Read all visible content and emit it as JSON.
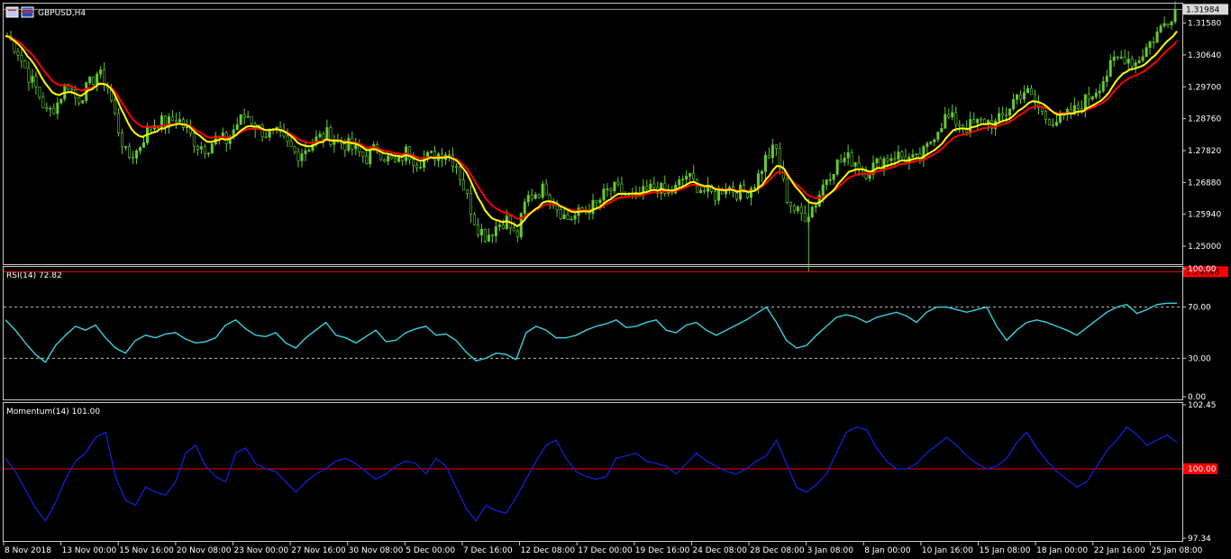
{
  "window": {
    "symbol_title": "GBPUSD,H4"
  },
  "colors": {
    "background": "#000000",
    "frame": "#c8c8c8",
    "candle": "#66cc33",
    "ma_fast": "#ffff00",
    "ma_slow": "#ff0000",
    "rsi_line": "#3ad0e0",
    "momentum_line": "#1020c8",
    "level_line": "#ff0000",
    "label_text": "#ffffff",
    "price_box_bg": "#d8d8d8",
    "price_box_red": "#ff0000"
  },
  "chart_data": [
    {
      "type": "candlestick",
      "panel": "price",
      "title": "GBPUSD,H4",
      "ylim": [
        1.2455,
        1.321
      ],
      "y_ticks": [
        "1.31580",
        "1.30640",
        "1.29700",
        "1.28760",
        "1.27820",
        "1.26880",
        "1.25940",
        "1.25000"
      ],
      "current_price_label": "1.31984",
      "current_price": 1.31984,
      "low_line_label": "1.24248",
      "low_line": 1.24248,
      "close_path": [
        1.312,
        1.308,
        1.301,
        1.296,
        1.289,
        1.292,
        1.2985,
        1.293,
        1.2965,
        1.301,
        1.298,
        1.286,
        1.276,
        1.278,
        1.284,
        1.287,
        1.286,
        1.288,
        1.284,
        1.28,
        1.279,
        1.282,
        1.281,
        1.286,
        1.289,
        1.285,
        1.283,
        1.283,
        1.28,
        1.277,
        1.279,
        1.2815,
        1.283,
        1.281,
        1.28,
        1.278,
        1.276,
        1.279,
        1.276,
        1.274,
        1.278,
        1.275,
        1.276,
        1.277,
        1.278,
        1.274,
        1.265,
        1.256,
        1.253,
        1.256,
        1.258,
        1.252,
        1.264,
        1.266,
        1.267,
        1.262,
        1.258,
        1.259,
        1.261,
        1.262,
        1.266,
        1.267,
        1.265,
        1.264,
        1.266,
        1.268,
        1.265,
        1.267,
        1.271,
        1.268,
        1.266,
        1.265,
        1.268,
        1.266,
        1.266,
        1.269,
        1.276,
        1.279,
        1.265,
        1.26,
        1.259,
        1.263,
        1.27,
        1.274,
        1.276,
        1.275,
        1.272,
        1.274,
        1.276,
        1.277,
        1.276,
        1.275,
        1.278,
        1.284,
        1.288,
        1.287,
        1.285,
        1.286,
        1.287,
        1.286,
        1.289,
        1.294,
        1.296,
        1.292,
        1.288,
        1.287,
        1.288,
        1.29,
        1.293,
        1.296,
        1.3,
        1.305,
        1.306,
        1.304,
        1.308,
        1.312,
        1.316,
        1.3198
      ]
    },
    {
      "type": "line",
      "panel": "rsi",
      "title": "RSI(14) 72.82",
      "ylim": [
        0,
        100
      ],
      "y_ticks": [
        "100.00",
        "70.00",
        "30.00",
        "0.00"
      ],
      "levels": [
        70,
        30
      ],
      "series": [
        {
          "name": "RSI(14)",
          "values": [
            60,
            52,
            42,
            33,
            27,
            40,
            48,
            55,
            52,
            56,
            46,
            38,
            34,
            44,
            48,
            46,
            49,
            50,
            45,
            42,
            43,
            46,
            56,
            60,
            53,
            48,
            47,
            50,
            42,
            38,
            46,
            52,
            58,
            48,
            46,
            42,
            47,
            52,
            43,
            44,
            50,
            53,
            55,
            48,
            49,
            44,
            35,
            28,
            30,
            34,
            33,
            29,
            50,
            55,
            52,
            46,
            46,
            48,
            52,
            55,
            57,
            60,
            54,
            55,
            58,
            60,
            52,
            50,
            56,
            58,
            52,
            48,
            52,
            56,
            60,
            65,
            70,
            58,
            44,
            38,
            40,
            48,
            55,
            62,
            64,
            62,
            58,
            62,
            64,
            66,
            63,
            58,
            66,
            70,
            70,
            68,
            66,
            68,
            70,
            55,
            44,
            52,
            58,
            60,
            58,
            55,
            52,
            48,
            54,
            60,
            66,
            70,
            72,
            65,
            68,
            72,
            73,
            73
          ]
        }
      ]
    },
    {
      "type": "line",
      "panel": "momentum",
      "title": "Momentum(14) 101.00",
      "ylim": [
        97.34,
        102.45
      ],
      "y_ticks": [
        "102.45",
        "100.00",
        "97.34"
      ],
      "levels": [
        100.0
      ],
      "series": [
        {
          "name": "Momentum(14)",
          "values": [
            100.4,
            99.9,
            99.2,
            98.5,
            98.0,
            98.7,
            99.6,
            100.3,
            100.6,
            101.2,
            101.4,
            99.7,
            98.8,
            98.6,
            99.3,
            99.1,
            99.0,
            99.5,
            100.6,
            100.9,
            100.1,
            99.7,
            99.5,
            100.6,
            100.8,
            100.2,
            100.0,
            99.9,
            99.5,
            99.1,
            99.5,
            99.8,
            100.0,
            100.3,
            100.4,
            100.2,
            99.9,
            99.6,
            99.8,
            100.1,
            100.3,
            100.2,
            99.8,
            100.4,
            100.1,
            99.3,
            98.5,
            98.0,
            98.6,
            98.4,
            98.3,
            98.9,
            99.6,
            100.3,
            100.9,
            101.1,
            100.4,
            99.9,
            99.7,
            99.6,
            99.7,
            100.4,
            100.5,
            100.6,
            100.3,
            100.2,
            100.1,
            99.8,
            100.2,
            100.6,
            100.3,
            100.1,
            99.9,
            99.8,
            100.0,
            100.3,
            100.5,
            101.1,
            100.2,
            99.3,
            99.1,
            99.4,
            99.8,
            100.6,
            101.4,
            101.6,
            101.5,
            100.8,
            100.3,
            100.0,
            100.0,
            100.2,
            100.6,
            100.9,
            101.2,
            100.9,
            100.5,
            100.2,
            100.0,
            100.1,
            100.4,
            101.0,
            101.4,
            100.8,
            100.3,
            99.9,
            99.6,
            99.3,
            99.5,
            100.1,
            100.7,
            101.1,
            101.6,
            101.3,
            100.9,
            101.1,
            101.3,
            101.0
          ]
        }
      ]
    }
  ],
  "x_axis_labels": [
    "8 Nov 2018",
    "13 Nov 00:00",
    "15 Nov 16:00",
    "20 Nov 08:00",
    "23 Nov 00:00",
    "27 Nov 16:00",
    "30 Nov 08:00",
    "5 Dec 00:00",
    "7 Dec 16:00",
    "12 Dec 08:00",
    "17 Dec 00:00",
    "19 Dec 16:00",
    "24 Dec 08:00",
    "28 Dec 08:00",
    "3 Jan 08:00",
    "8 Jan 00:00",
    "10 Jan 16:00",
    "15 Jan 08:00",
    "18 Jan 00:00",
    "22 Jan 16:00",
    "25 Jan 08:00"
  ]
}
